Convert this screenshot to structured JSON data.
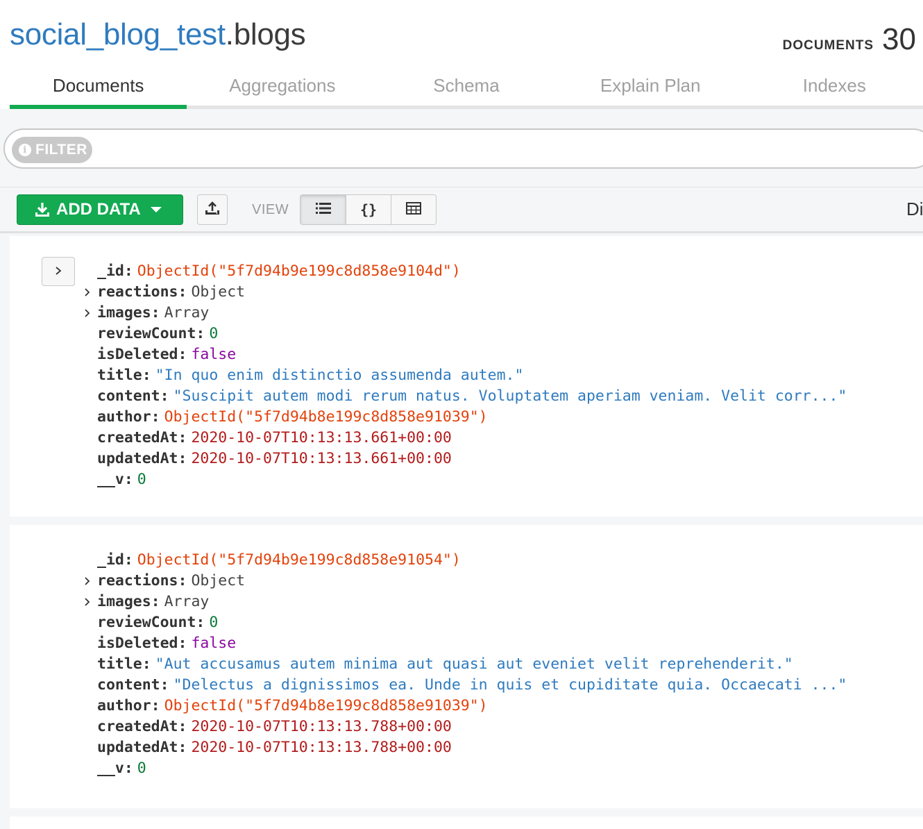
{
  "namespace": {
    "database": "social_blog_test",
    "separator": ".",
    "collection": "blogs"
  },
  "documents_count": {
    "label": "DOCUMENTS",
    "value": "30"
  },
  "tabs": [
    {
      "label": "Documents",
      "active": true
    },
    {
      "label": "Aggregations",
      "active": false
    },
    {
      "label": "Schema",
      "active": false
    },
    {
      "label": "Explain Plan",
      "active": false
    },
    {
      "label": "Indexes",
      "active": false
    }
  ],
  "filter": {
    "label": "FILTER",
    "info_glyph": "i"
  },
  "toolbar": {
    "add_data_label": "ADD DATA",
    "view_label": "VIEW",
    "view_json_glyph": "{}",
    "cut_off_label": "Di"
  },
  "colors": {
    "accent_green": "#13aa52",
    "db_blue": "#2f7bbf",
    "objectid": "#e3420b",
    "string": "#2f7bbf",
    "number": "#0a7a3a",
    "boolean": "#8a0aa0",
    "date": "#b31b1b"
  },
  "documents": [
    {
      "fields": [
        {
          "key": "_id",
          "value": "ObjectId(\"5f7d94b9e199c8d858e9104d\")",
          "type": "oid"
        },
        {
          "key": "reactions",
          "value": "Object",
          "type": "type",
          "expandable": true
        },
        {
          "key": "images",
          "value": "Array",
          "type": "type",
          "expandable": true
        },
        {
          "key": "reviewCount",
          "value": "0",
          "type": "num"
        },
        {
          "key": "isDeleted",
          "value": "false",
          "type": "bool"
        },
        {
          "key": "title",
          "value": "\"In quo enim distinctio assumenda autem.\"",
          "type": "str"
        },
        {
          "key": "content",
          "value": "\"Suscipit autem modi rerum natus. Voluptatem aperiam veniam. Velit corr...\"",
          "type": "str"
        },
        {
          "key": "author",
          "value": "ObjectId(\"5f7d94b8e199c8d858e91039\")",
          "type": "oid"
        },
        {
          "key": "createdAt",
          "value": "2020-10-07T10:13:13.661+00:00",
          "type": "date"
        },
        {
          "key": "updatedAt",
          "value": "2020-10-07T10:13:13.661+00:00",
          "type": "date"
        },
        {
          "key": "__v",
          "value": "0",
          "type": "num"
        }
      ]
    },
    {
      "fields": [
        {
          "key": "_id",
          "value": "ObjectId(\"5f7d94b9e199c8d858e91054\")",
          "type": "oid"
        },
        {
          "key": "reactions",
          "value": "Object",
          "type": "type",
          "expandable": true
        },
        {
          "key": "images",
          "value": "Array",
          "type": "type",
          "expandable": true
        },
        {
          "key": "reviewCount",
          "value": "0",
          "type": "num"
        },
        {
          "key": "isDeleted",
          "value": "false",
          "type": "bool"
        },
        {
          "key": "title",
          "value": "\"Aut accusamus autem minima aut quasi aut eveniet velit reprehenderit.\"",
          "type": "str"
        },
        {
          "key": "content",
          "value": "\"Delectus a dignissimos ea. Unde in quis et cupiditate quia. Occaecati ...\"",
          "type": "str"
        },
        {
          "key": "author",
          "value": "ObjectId(\"5f7d94b8e199c8d858e91039\")",
          "type": "oid"
        },
        {
          "key": "createdAt",
          "value": "2020-10-07T10:13:13.788+00:00",
          "type": "date"
        },
        {
          "key": "updatedAt",
          "value": "2020-10-07T10:13:13.788+00:00",
          "type": "date"
        },
        {
          "key": "__v",
          "value": "0",
          "type": "num"
        }
      ]
    }
  ]
}
